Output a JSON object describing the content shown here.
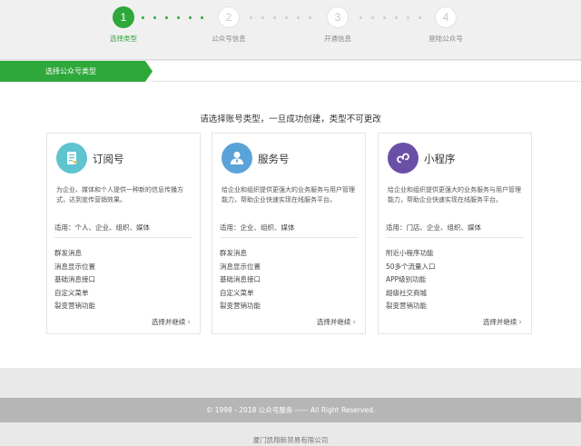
{
  "steps": [
    {
      "number": "1",
      "label": "选择类型",
      "active": true
    },
    {
      "number": "2",
      "label": "公众号信息",
      "active": false
    },
    {
      "number": "3",
      "label": "开通信息",
      "active": false
    },
    {
      "number": "4",
      "label": "登陆公众号",
      "active": false
    }
  ],
  "section_tab": "选择公众号类型",
  "heading": "请选择账号类型，一旦成功创建，类型不可更改",
  "cards": [
    {
      "title": "订阅号",
      "icon": "subscription-doc-icon",
      "icon_color": "#5dc4d0",
      "desc": "为企业、媒体和个人提供一种新的信息传播方式，达到宣传营销效果。",
      "suitable": "适用：个人、企业、组织、媒体",
      "features": [
        "群发消息",
        "消息显示位置",
        "基础消息接口",
        "自定义菜单",
        "裂变营销功能"
      ],
      "select": "选择并继续"
    },
    {
      "title": "服务号",
      "icon": "service-user-icon",
      "icon_color": "#5aa3d9",
      "desc": "给企业和组织提供更强大的业务服务与用户管理能力，帮助企业快速实现在线服务平台。",
      "suitable": "适用：企业、组织、媒体",
      "features": [
        "群发消息",
        "消息显示位置",
        "基础消息接口",
        "自定义菜单",
        "裂变营销功能"
      ],
      "select": "选择并继续"
    },
    {
      "title": "小程序",
      "icon": "mini-program-icon",
      "icon_color": "#6a4fa7",
      "desc": "给企业和组织提供更强大的业务服务与用户管理能力，帮助企业快速实现在线服务平台。",
      "suitable": "适用：门店、企业、组织、媒体",
      "features": [
        "附近小程序功能",
        "50多个流量入口",
        "APP级别功能",
        "超级社交商城",
        "裂变营销功能"
      ],
      "select": "选择并继续"
    }
  ],
  "footer": {
    "copyright": "© 1998 - 2018 公众号服务 —— All Right Reserved.",
    "company": "厦门凯翔新贸易有限公司"
  },
  "colors": {
    "accent": "#2ea83a"
  }
}
